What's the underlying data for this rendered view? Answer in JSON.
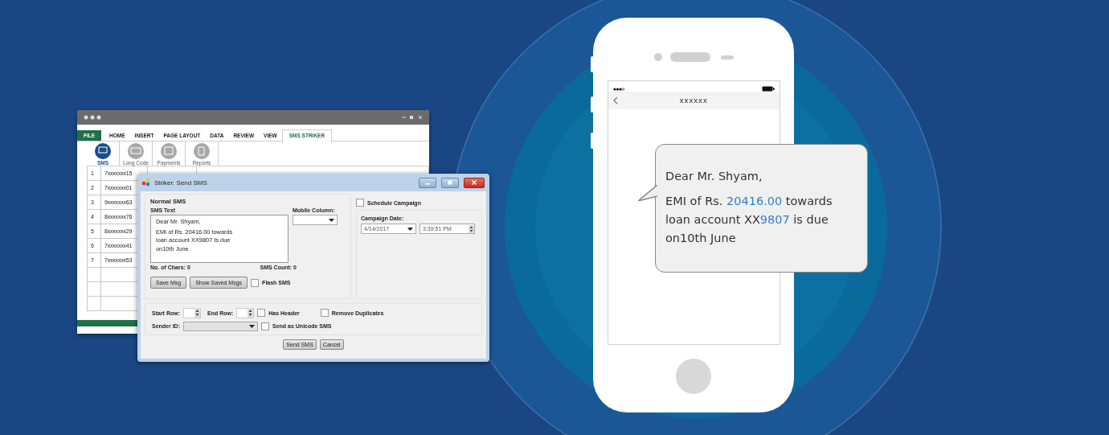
{
  "spreadsheet_window": {
    "menu_tabs": [
      {
        "label": "FILE",
        "kind": "file",
        "selected": false
      },
      {
        "label": "HOME",
        "kind": "tab",
        "selected": false
      },
      {
        "label": "INSERT",
        "kind": "tab",
        "selected": false
      },
      {
        "label": "PAGE LAYOUT",
        "kind": "tab",
        "selected": false
      },
      {
        "label": "DATA",
        "kind": "tab",
        "selected": false
      },
      {
        "label": "REVIEW",
        "kind": "tab",
        "selected": false
      },
      {
        "label": "VIEW",
        "kind": "tab",
        "selected": false
      },
      {
        "label": "SMS STRIKER",
        "kind": "tab",
        "selected": true
      }
    ],
    "ribbon_buttons": [
      {
        "label": "SMS",
        "kind": "sms",
        "selected": true
      },
      {
        "label": "Long Code",
        "kind": "code",
        "selected": false
      },
      {
        "label": "Payments",
        "kind": "payments",
        "selected": false
      },
      {
        "label": "Reports",
        "kind": "reports",
        "selected": false
      }
    ],
    "rows": [
      {
        "number": "1",
        "mobile": "7xxxxxxx15"
      },
      {
        "number": "2",
        "mobile": "7xxxxxxx01"
      },
      {
        "number": "3",
        "mobile": "9xxxxxxx63"
      },
      {
        "number": "4",
        "mobile": "8xxxxxxx76"
      },
      {
        "number": "5",
        "mobile": "8xxxxxxx29"
      },
      {
        "number": "6",
        "mobile": "7xxxxxxx41"
      },
      {
        "number": "7",
        "mobile": "7xxxxxxx53"
      }
    ]
  },
  "dialog": {
    "title": "Striker: Send SMS",
    "group_title": "Normal SMS",
    "sms_text_label": "SMS Text",
    "sms_text": [
      "Dear Mr. Shyam,",
      "EMI of Rs. 20416.00 towards\nloan account XX9807 Is due\non10th June"
    ],
    "mobile_column_label": "Mobile Column:",
    "chars_count": "No. of Chars: 0",
    "sms_count": "SMS Count: 0",
    "buttons": [
      "Save Msg",
      "Show Saved Msgs"
    ],
    "flash_sms": {
      "label": "Flash SMS",
      "checked": false
    },
    "schedule_campaign": {
      "label": "Schedule Campaign",
      "checked": false
    },
    "campaign_date_label": "Campaign Date:",
    "campaign_date": "4/14/2017",
    "campaign_time": "3:39:51 PM",
    "start_row_label": "Start Row:",
    "end_row_label": "End Row:",
    "has_header": {
      "label": "Has Header",
      "checked": false
    },
    "remove_duplicates": {
      "label": "Remove Duplicates",
      "checked": false
    },
    "sender_id_label": "Sender ID:",
    "send_unicode": {
      "label": "Send as Unicode SMS",
      "checked": false
    },
    "footer_buttons": [
      "Send SMS",
      "Cancel"
    ]
  },
  "phone": {
    "contact": "xxxxxx",
    "message": [
      [
        {
          "text": "Dear Mr. Shyam,",
          "highlight": false
        }
      ],
      [
        {
          "text": "EMI of Rs. ",
          "highlight": false
        },
        {
          "text": "20416.00",
          "highlight": true
        },
        {
          "text": " towards loan account XX",
          "highlight": false
        },
        {
          "text": "9807",
          "highlight": true
        },
        {
          "text": " is due on10th June",
          "highlight": false
        }
      ]
    ]
  }
}
